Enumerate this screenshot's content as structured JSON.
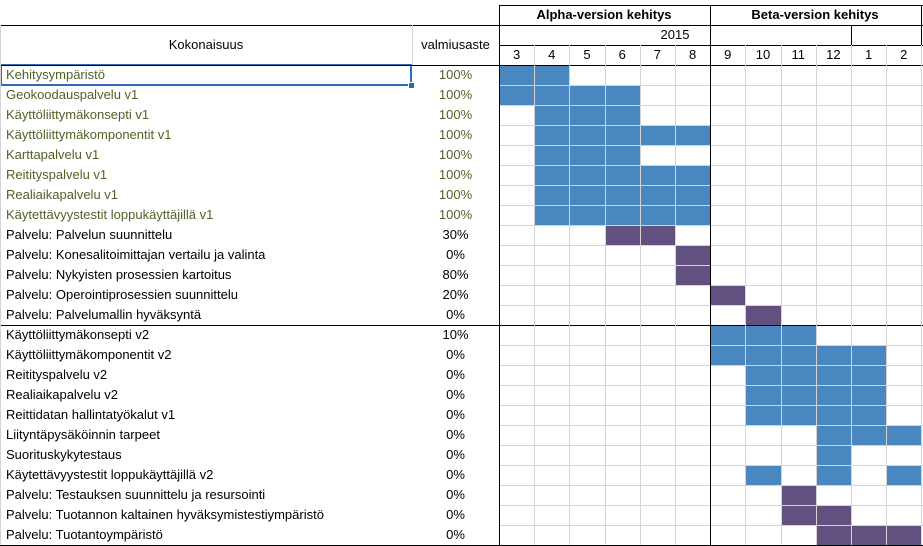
{
  "headers": {
    "kokonaisuus": "Kokonaisuus",
    "valmiusaste": "valmiusaste",
    "alpha": "Alpha-version kehitys",
    "beta": "Beta-version kehitys",
    "year": "2015"
  },
  "months": [
    "3",
    "4",
    "5",
    "6",
    "7",
    "8",
    "9",
    "10",
    "11",
    "12",
    "1",
    "2"
  ],
  "colors": {
    "blue": "#4a86c0",
    "purple": "#625180",
    "green_text": "#4f6228"
  },
  "rows": [
    {
      "name": "Kehitysympäristö",
      "pct": "100%",
      "green": true,
      "selected": true,
      "bars": [
        {
          "from": 0,
          "to": 1,
          "kind": "blue"
        }
      ]
    },
    {
      "name": "Geokoodauspalvelu v1",
      "pct": "100%",
      "green": true,
      "bars": [
        {
          "from": 0,
          "to": 3,
          "kind": "blue"
        }
      ]
    },
    {
      "name": "Käyttöliittymäkonsepti v1",
      "pct": "100%",
      "green": true,
      "bars": [
        {
          "from": 1,
          "to": 3,
          "kind": "blue"
        }
      ]
    },
    {
      "name": "Käyttöliittymäkomponentit v1",
      "pct": "100%",
      "green": true,
      "bars": [
        {
          "from": 1,
          "to": 5,
          "kind": "blue"
        }
      ]
    },
    {
      "name": "Karttapalvelu v1",
      "pct": "100%",
      "green": true,
      "bars": [
        {
          "from": 1,
          "to": 3,
          "kind": "blue"
        }
      ]
    },
    {
      "name": "Reitityspalvelu v1",
      "pct": "100%",
      "green": true,
      "bars": [
        {
          "from": 1,
          "to": 5,
          "kind": "blue"
        }
      ]
    },
    {
      "name": "Realiaikapalvelu v1",
      "pct": "100%",
      "green": true,
      "bars": [
        {
          "from": 1,
          "to": 5,
          "kind": "blue"
        }
      ]
    },
    {
      "name": "Käytettävyystestit loppukäyttäjillä v1",
      "pct": "100%",
      "green": true,
      "bars": [
        {
          "from": 1,
          "to": 5,
          "kind": "blue"
        }
      ]
    },
    {
      "name": "Palvelu: Palvelun suunnittelu",
      "pct": "30%",
      "bars": [
        {
          "from": 3,
          "to": 4,
          "kind": "purple"
        }
      ]
    },
    {
      "name": "Palvelu: Konesalitoimittajan vertailu ja valinta",
      "pct": "0%",
      "bars": [
        {
          "from": 5,
          "to": 5,
          "kind": "purple"
        }
      ]
    },
    {
      "name": "Palvelu: Nykyisten prosessien kartoitus",
      "pct": "80%",
      "bars": [
        {
          "from": 5,
          "to": 5,
          "kind": "purple"
        }
      ]
    },
    {
      "name": "Palvelu: Operointiprosessien suunnittelu",
      "pct": "20%",
      "bars": [
        {
          "from": 6,
          "to": 6,
          "kind": "purple"
        }
      ]
    },
    {
      "name": "Palvelu: Palvelumallin hyväksyntä",
      "pct": "0%",
      "bars": [
        {
          "from": 7,
          "to": 7,
          "kind": "purple"
        }
      ]
    },
    {
      "name": "Käyttöliittymäkonsepti v2",
      "pct": "10%",
      "bars": [
        {
          "from": 6,
          "to": 8,
          "kind": "blue"
        }
      ]
    },
    {
      "name": "Käyttöliittymäkomponentit v2",
      "pct": "0%",
      "bars": [
        {
          "from": 6,
          "to": 10,
          "kind": "blue"
        }
      ]
    },
    {
      "name": "Reitityspalvelu v2",
      "pct": "0%",
      "bars": [
        {
          "from": 7,
          "to": 10,
          "kind": "blue"
        }
      ]
    },
    {
      "name": "Realiaikapalvelu v2",
      "pct": "0%",
      "bars": [
        {
          "from": 7,
          "to": 10,
          "kind": "blue"
        }
      ]
    },
    {
      "name": "Reittidatan hallintatyökalut v1",
      "pct": "0%",
      "bars": [
        {
          "from": 7,
          "to": 10,
          "kind": "blue"
        }
      ]
    },
    {
      "name": "Liityntäpysäköinnin tarpeet",
      "pct": "0%",
      "bars": [
        {
          "from": 9,
          "to": 11,
          "kind": "blue"
        }
      ]
    },
    {
      "name": "Suorituskykytestaus",
      "pct": "0%",
      "bars": [
        {
          "from": 9,
          "to": 9,
          "kind": "blue"
        }
      ]
    },
    {
      "name": "Käytettävyystestit loppukäyttäjillä v2",
      "pct": "0%",
      "bars": [
        {
          "from": 7,
          "to": 7,
          "kind": "blue"
        },
        {
          "from": 9,
          "to": 9,
          "kind": "blue"
        },
        {
          "from": 11,
          "to": 11,
          "kind": "blue"
        }
      ]
    },
    {
      "name": "Palvelu: Testauksen suunnittelu ja resursointi",
      "pct": "0%",
      "bars": [
        {
          "from": 8,
          "to": 8,
          "kind": "purple"
        }
      ]
    },
    {
      "name": "Palvelu: Tuotannon kaltainen hyväksymistestiympäristö",
      "pct": "0%",
      "bars": [
        {
          "from": 8,
          "to": 9,
          "kind": "purple"
        }
      ]
    },
    {
      "name": "Palvelu: Tuotantoympäristö",
      "pct": "0%",
      "bars": [
        {
          "from": 9,
          "to": 11,
          "kind": "purple"
        }
      ]
    }
  ]
}
